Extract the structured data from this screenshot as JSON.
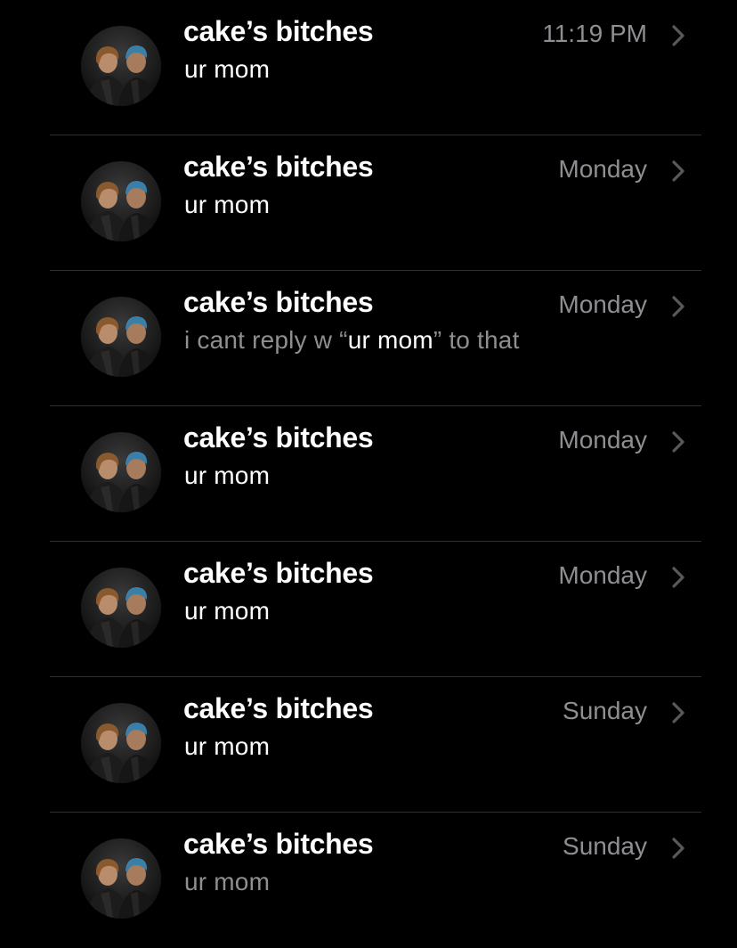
{
  "colors": {
    "background": "#000000",
    "primary_text": "#ffffff",
    "secondary_text": "#8e8e93",
    "separator": "#2e2e30"
  },
  "conversations": [
    {
      "name": "cake’s bitches",
      "time": "11:19 PM",
      "preview": "ur mom",
      "avatar_icon": "group-avatar",
      "chevron_icon": "chevron-right-icon"
    },
    {
      "name": "cake’s bitches",
      "time": "Monday",
      "preview": "ur mom",
      "avatar_icon": "group-avatar",
      "chevron_icon": "chevron-right-icon"
    },
    {
      "name": "cake’s bitches",
      "time": "Monday",
      "preview_before": "i cant reply w “",
      "preview_highlight": "ur mom",
      "preview_after": "” to that",
      "avatar_icon": "group-avatar",
      "chevron_icon": "chevron-right-icon"
    },
    {
      "name": "cake’s bitches",
      "time": "Monday",
      "preview": "ur mom",
      "avatar_icon": "group-avatar",
      "chevron_icon": "chevron-right-icon"
    },
    {
      "name": "cake’s bitches",
      "time": "Monday",
      "preview": "ur mom",
      "avatar_icon": "group-avatar",
      "chevron_icon": "chevron-right-icon"
    },
    {
      "name": "cake’s bitches",
      "time": "Sunday",
      "preview": "ur mom",
      "avatar_icon": "group-avatar",
      "chevron_icon": "chevron-right-icon"
    },
    {
      "name": "cake’s bitches",
      "time": "Sunday",
      "preview": "ur mom",
      "preview_dimmed": true,
      "avatar_icon": "group-avatar",
      "chevron_icon": "chevron-right-icon"
    }
  ]
}
